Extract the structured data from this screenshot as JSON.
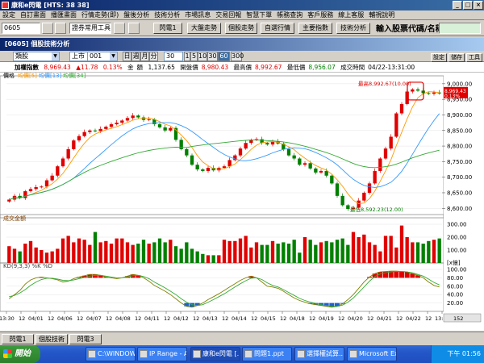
{
  "window": {
    "title": "康和e閃電 [HTS: 38 38]",
    "minimize_label": "_",
    "maximize_label": "□",
    "close_label": "×"
  },
  "menu": [
    "設定",
    "自訂畫面",
    "播匯畫面",
    "行情走勢(即)",
    "盤後分析",
    "技術分析",
    "市場訊息",
    "交易回報",
    "智慧下單",
    "帳務查詢",
    "客戶服務",
    "線上客服",
    "輔視說明"
  ],
  "toolbar": {
    "stock_code": "0605",
    "tools_select": "證券常用工具",
    "buttons": [
      "閃電1",
      "大盤走勢",
      "個股走勢",
      "自選行情",
      "主要指數",
      "技術分析"
    ],
    "search_label": "輸入股票代碼/名稱:",
    "search_value": ""
  },
  "panel": {
    "title": "[0605] 個股技術分析",
    "side_buttons": [
      "設定",
      "儲存",
      "工具"
    ]
  },
  "controls": {
    "category": "類股",
    "market": "上市",
    "code": "001",
    "periods": [
      "日",
      "週",
      "月",
      "分"
    ],
    "count_value": "30",
    "minutes": [
      "1",
      "5",
      "10",
      "30",
      "60"
    ],
    "active_minute": "60",
    "extra": "300"
  },
  "quote": {
    "name": "加權指數",
    "price": "8,969.43",
    "change": "▲11.78",
    "pct": "0.13%",
    "amount_label": "金",
    "amount": "額",
    "amount_value": "1,137.65",
    "open_label": "開盤價",
    "open": "8,980.43",
    "high_label": "最高價",
    "high": "8,992.67",
    "low_label": "最低價",
    "low": "8,956.07",
    "time_label": "成交時間",
    "time": "04/22-13:31:00"
  },
  "chart": {
    "price_legend": {
      "label": "價格",
      "ma5": "均價[5]",
      "ma13": "均價[13]",
      "ma34": "均價[34]"
    },
    "price_yaxis": [
      "9,000.00",
      "8,950.00",
      "8,900.00",
      "8,850.00",
      "8,800.00",
      "8,750.00",
      "8,700.00",
      "8,650.00",
      "8,600.00"
    ],
    "current_price_tag": "8,969.43",
    "current_pct_tag": "0.13%",
    "high_annotation": "最高8,992.67(10.00)",
    "low_annotation": "最低8,592.23(12.00)",
    "volume_label": "成交金額",
    "volume_yaxis": [
      "300.00",
      "200.00",
      "100.00",
      "[x億]"
    ],
    "kd_label": "KD(9,3,3) %K %D",
    "kd_yaxis": [
      "100.00",
      "80.00",
      "60.00",
      "40.00",
      "20.00"
    ],
    "xaxis": [
      "13:30",
      "12",
      "04/01",
      "12",
      "04/06",
      "12",
      "04/07",
      "12",
      "04/08",
      "12",
      "04/11",
      "12",
      "04/12",
      "12",
      "04/13",
      "12",
      "04/14",
      "12",
      "04/15",
      "12",
      "04/18",
      "12",
      "04/19",
      "12",
      "04/20",
      "12",
      "04/21",
      "12",
      "04/22",
      "12",
      "13:30"
    ],
    "scroll_value": "152"
  },
  "chart_data": {
    "type": "candlestick",
    "title": "加權指數",
    "ylim": [
      8580,
      9010
    ],
    "close": [
      8628,
      8640,
      8633,
      8655,
      8662,
      8668,
      8670,
      8690,
      8705,
      8735,
      8760,
      8790,
      8818,
      8832,
      8845,
      8850,
      8848,
      8855,
      8862,
      8870,
      8875,
      8882,
      8890,
      8898,
      8892,
      8884,
      8886,
      8870,
      8860,
      8850,
      8858,
      8820,
      8790,
      8770,
      8740,
      8725,
      8720,
      8730,
      8722,
      8730,
      8735,
      8755,
      8770,
      8792,
      8810,
      8820,
      8822,
      8810,
      8805,
      8815,
      8808,
      8790,
      8770,
      8760,
      8740,
      8745,
      8728,
      8715,
      8720,
      8705,
      8680,
      8640,
      8610,
      8598,
      8602,
      8625,
      8650,
      8680,
      8720,
      8760,
      8792,
      8830,
      8905,
      8935,
      8975,
      8982,
      8978,
      8970,
      8968,
      8972,
      8969
    ],
    "volume": [
      130,
      110,
      90,
      150,
      170,
      120,
      100,
      80,
      90,
      110,
      190,
      210,
      160,
      190,
      180,
      140,
      240,
      160,
      170,
      150,
      190,
      190,
      160,
      140,
      150,
      180,
      150,
      160,
      190,
      160,
      180,
      130,
      110,
      160,
      110,
      90,
      70,
      60,
      60,
      60,
      180,
      170,
      170,
      190,
      210,
      120,
      160,
      140,
      140,
      170,
      150,
      160,
      150,
      180,
      80,
      200,
      180,
      140,
      160,
      170,
      160,
      180,
      190,
      140,
      240,
      200,
      220,
      160,
      140,
      90,
      210,
      210,
      120,
      290,
      200,
      160,
      160,
      150,
      170,
      180,
      190
    ],
    "k": [
      30,
      40,
      50,
      65,
      75,
      80,
      82,
      80,
      78,
      75,
      70,
      72,
      78,
      82,
      85,
      88,
      88,
      86,
      82,
      80,
      78,
      80,
      84,
      88,
      86,
      80,
      72,
      62,
      55,
      48,
      40,
      30,
      20,
      12,
      10,
      14,
      20,
      28,
      35,
      42,
      50,
      58,
      66,
      74,
      80,
      84,
      80,
      70,
      60,
      58,
      55,
      48,
      40,
      32,
      26,
      22,
      18,
      16,
      14,
      12,
      10,
      12,
      18,
      28,
      40,
      55,
      70,
      82,
      90,
      94,
      95,
      96,
      96,
      95,
      94,
      90,
      86,
      80,
      70,
      62,
      58
    ],
    "d": [
      35,
      38,
      44,
      52,
      62,
      70,
      76,
      79,
      79,
      77,
      74,
      73,
      75,
      78,
      81,
      84,
      86,
      86,
      84,
      82,
      80,
      80,
      82,
      85,
      86,
      83,
      78,
      70,
      63,
      56,
      48,
      40,
      30,
      22,
      16,
      14,
      16,
      22,
      28,
      35,
      42,
      50,
      58,
      66,
      73,
      79,
      80,
      76,
      68,
      62,
      58,
      52,
      45,
      38,
      31,
      26,
      22,
      19,
      16,
      14,
      12,
      12,
      15,
      22,
      32,
      45,
      58,
      72,
      83,
      89,
      92,
      94,
      95,
      95,
      94,
      92,
      88,
      84,
      77,
      69,
      63
    ]
  },
  "bottom_tabs": [
    "閃電1",
    "個股技術",
    "閃電3"
  ],
  "taskbar": {
    "start": "開始",
    "tasks": [
      "C:\\WINDOWS...",
      "IP Range - An...",
      "康和e閃電 [...",
      "問題1.ppt",
      "選擇權試算...",
      "Microsoft Excel ..."
    ],
    "clock": "下午 01:56"
  }
}
